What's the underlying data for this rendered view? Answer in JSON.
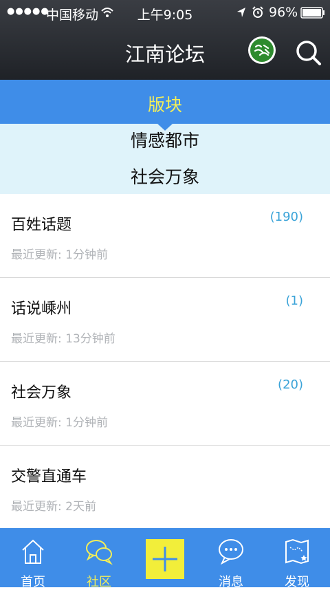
{
  "status_bar": {
    "signal": "●●●●●",
    "carrier": "中国移动",
    "time": "上午9:05",
    "battery": "96%",
    "icons": [
      "wifi-icon",
      "location-icon",
      "alarm-icon",
      "battery-icon"
    ]
  },
  "nav": {
    "title": "江南论坛",
    "logo_icon": "jiangnan-logo-icon",
    "search_icon": "search-icon"
  },
  "section": {
    "tab_label": "版块",
    "dropdown_items": [
      "情感都市",
      "社会万象"
    ]
  },
  "forums": [
    {
      "name": "百姓话题",
      "count": "(190)",
      "updated": "最近更新: 1分钟前"
    },
    {
      "name": "话说嵊州",
      "count": "(1)",
      "updated": "最近更新: 13分钟前"
    },
    {
      "name": "社会万象",
      "count": "(20)",
      "updated": "最近更新: 1分钟前"
    },
    {
      "name": "交警直通车",
      "count": "",
      "updated": "最近更新: 2天前"
    }
  ],
  "tabbar": {
    "items": [
      {
        "label": "首页",
        "icon": "home-icon"
      },
      {
        "label": "社区",
        "icon": "chat-bubbles-icon",
        "active": true
      },
      {
        "label": "",
        "icon": "plus-icon"
      },
      {
        "label": "消息",
        "icon": "message-icon"
      },
      {
        "label": "发现",
        "icon": "map-icon"
      }
    ]
  },
  "colors": {
    "accent_blue": "#3f8de8",
    "highlight_yellow": "#f2ee5a",
    "dropdown_bg": "#dff3fa",
    "count_blue": "#3aa3d8"
  }
}
